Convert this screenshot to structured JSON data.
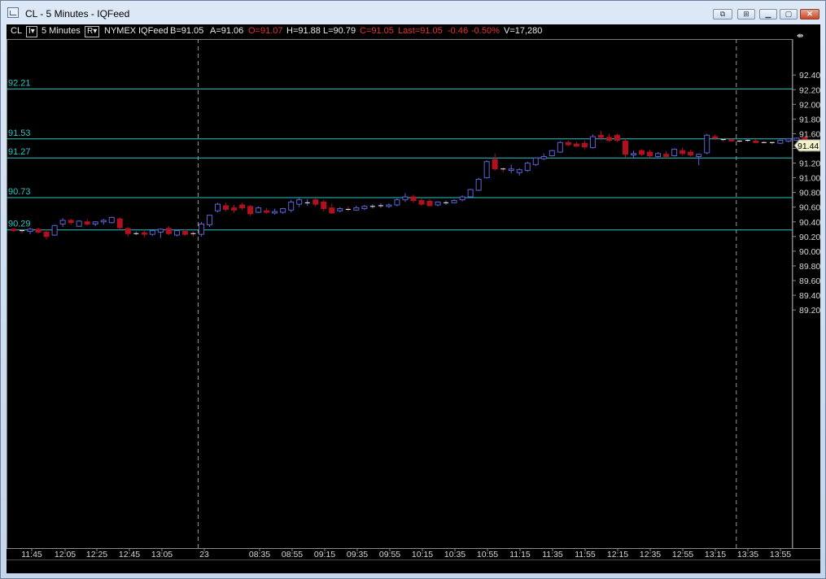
{
  "window": {
    "title": "CL - 5 Minutes - IQFeed",
    "buttons": [
      {
        "name": "restore-pane-button",
        "glyph": "⧉"
      },
      {
        "name": "tile-button",
        "glyph": "⊞"
      },
      {
        "name": "minimize-button",
        "glyph": "▁"
      },
      {
        "name": "maximize-button",
        "glyph": "▢"
      },
      {
        "name": "close-button",
        "glyph": "✕"
      }
    ]
  },
  "header": {
    "symbol": "CL",
    "interval_box": "I▾",
    "interval": "5 Minutes",
    "range_box": "R▾",
    "exchange": "NYMEX",
    "feed": "IQFeed",
    "bid": "B=91.05",
    "ask": "A=91.06",
    "open": "O=91.07",
    "high": "H=91.88",
    "low": "L=90.79",
    "close": "C=91.05",
    "last": "Last=91.05",
    "change": "-0.46",
    "change_pct": "-0.50%",
    "volume": "V=17,280",
    "expand_icon": "⇼"
  },
  "colors": {
    "background": "#000000",
    "up_candle": "#5d63d6",
    "down_candle": "#b01020",
    "level_line": "#2ec6c6",
    "axis_text": "#d6d6d6",
    "header_red": "#e53232",
    "last_price_tag": "#f2f2cc"
  },
  "levels": [
    "92.21",
    "91.53",
    "91.27",
    "90.73",
    "90.29"
  ],
  "last_price_tag": "91.44",
  "chart_data": {
    "type": "candlestick",
    "ylim": [
      89.2,
      92.6
    ],
    "y_ticks": [
      "92.40",
      "92.20",
      "92.00",
      "91.80",
      "91.60",
      "91.40",
      "91.20",
      "91.00",
      "90.80",
      "90.60",
      "90.40",
      "90.20",
      "90.00",
      "89.80",
      "89.60",
      "89.40",
      "89.20"
    ],
    "x_ticks": [
      "11:45",
      "12:05",
      "12:25",
      "12:45",
      "13:05",
      "23",
      "08:35",
      "08:55",
      "09:15",
      "09:35",
      "09:55",
      "10:15",
      "10:35",
      "10:55",
      "11:15",
      "11:35",
      "11:55",
      "12:15",
      "12:35",
      "12:55",
      "13:15",
      "13:35",
      "13:55"
    ],
    "session_breaks_after_bar": [
      22,
      88
    ],
    "candles": [
      [
        90.3,
        90.31,
        90.26,
        90.28
      ],
      [
        90.28,
        90.31,
        90.24,
        90.27
      ],
      [
        90.27,
        90.32,
        90.23,
        90.3
      ],
      [
        90.3,
        90.32,
        90.24,
        90.26
      ],
      [
        90.26,
        90.3,
        90.16,
        90.2
      ],
      [
        90.22,
        90.36,
        90.21,
        90.35
      ],
      [
        90.37,
        90.45,
        90.33,
        90.42
      ],
      [
        90.42,
        90.44,
        90.36,
        90.39
      ],
      [
        90.34,
        90.42,
        90.33,
        90.41
      ],
      [
        90.4,
        90.44,
        90.35,
        90.37
      ],
      [
        90.37,
        90.41,
        90.34,
        90.4
      ],
      [
        90.4,
        90.44,
        90.36,
        90.42
      ],
      [
        90.39,
        90.47,
        90.38,
        90.46
      ],
      [
        90.44,
        90.46,
        90.29,
        90.32
      ],
      [
        90.31,
        90.33,
        90.2,
        90.24
      ],
      [
        90.24,
        90.27,
        90.22,
        90.24
      ],
      [
        90.25,
        90.29,
        90.19,
        90.23
      ],
      [
        90.23,
        90.3,
        90.21,
        90.28
      ],
      [
        90.26,
        90.31,
        90.18,
        90.3
      ],
      [
        90.31,
        90.34,
        90.22,
        90.24
      ],
      [
        90.22,
        90.29,
        90.2,
        90.28
      ],
      [
        90.27,
        90.3,
        90.21,
        90.23
      ],
      [
        90.24,
        90.27,
        90.2,
        90.23
      ],
      [
        90.23,
        90.4,
        90.2,
        90.37
      ],
      [
        90.36,
        90.5,
        90.33,
        90.49
      ],
      [
        90.55,
        90.66,
        90.53,
        90.64
      ],
      [
        90.62,
        90.66,
        90.54,
        90.57
      ],
      [
        90.59,
        90.63,
        90.52,
        90.56
      ],
      [
        90.63,
        90.66,
        90.56,
        90.59
      ],
      [
        90.61,
        90.63,
        90.48,
        90.51
      ],
      [
        90.53,
        90.61,
        90.52,
        90.59
      ],
      [
        90.55,
        90.59,
        90.51,
        90.53
      ],
      [
        90.52,
        90.58,
        90.5,
        90.54
      ],
      [
        90.53,
        90.59,
        90.51,
        90.58
      ],
      [
        90.56,
        90.7,
        90.53,
        90.67
      ],
      [
        90.64,
        90.73,
        90.6,
        90.7
      ],
      [
        90.66,
        90.71,
        90.62,
        90.66
      ],
      [
        90.7,
        90.72,
        90.61,
        90.64
      ],
      [
        90.67,
        90.7,
        90.54,
        90.58
      ],
      [
        90.59,
        90.65,
        90.51,
        90.52
      ],
      [
        90.55,
        90.6,
        90.53,
        90.58
      ],
      [
        90.57,
        90.61,
        90.54,
        90.56
      ],
      [
        90.56,
        90.62,
        90.55,
        90.59
      ],
      [
        90.58,
        90.63,
        90.56,
        90.61
      ],
      [
        90.61,
        90.64,
        90.58,
        90.61
      ],
      [
        90.61,
        90.65,
        90.59,
        90.62
      ],
      [
        90.61,
        90.65,
        90.59,
        90.63
      ],
      [
        90.63,
        90.72,
        90.61,
        90.7
      ],
      [
        90.7,
        90.79,
        90.67,
        90.74
      ],
      [
        90.74,
        90.77,
        90.66,
        90.69
      ],
      [
        90.69,
        90.72,
        90.62,
        90.64
      ],
      [
        90.68,
        90.71,
        90.61,
        90.62
      ],
      [
        90.63,
        90.68,
        90.61,
        90.67
      ],
      [
        90.65,
        90.69,
        90.63,
        90.66
      ],
      [
        90.66,
        90.71,
        90.65,
        90.69
      ],
      [
        90.7,
        90.76,
        90.68,
        90.74
      ],
      [
        90.74,
        90.85,
        90.73,
        90.84
      ],
      [
        90.83,
        91.0,
        90.82,
        90.98
      ],
      [
        91.0,
        91.24,
        90.99,
        91.22
      ],
      [
        91.25,
        91.33,
        91.1,
        91.12
      ],
      [
        91.12,
        91.14,
        91.07,
        91.11
      ],
      [
        91.1,
        91.18,
        91.06,
        91.12
      ],
      [
        91.07,
        91.13,
        91.03,
        91.11
      ],
      [
        91.1,
        91.22,
        91.08,
        91.2
      ],
      [
        91.18,
        91.28,
        91.16,
        91.27
      ],
      [
        91.26,
        91.33,
        91.24,
        91.29
      ],
      [
        91.3,
        91.38,
        91.29,
        91.37
      ],
      [
        91.35,
        91.5,
        91.34,
        91.48
      ],
      [
        91.48,
        91.51,
        91.43,
        91.45
      ],
      [
        91.46,
        91.49,
        91.42,
        91.43
      ],
      [
        91.47,
        91.51,
        91.39,
        91.42
      ],
      [
        91.41,
        91.59,
        91.4,
        91.56
      ],
      [
        91.58,
        91.64,
        91.51,
        91.55
      ],
      [
        91.55,
        91.6,
        91.49,
        91.51
      ],
      [
        91.58,
        91.6,
        91.49,
        91.51
      ],
      [
        91.5,
        91.53,
        91.28,
        91.32
      ],
      [
        91.31,
        91.37,
        91.26,
        91.33
      ],
      [
        91.37,
        91.39,
        91.3,
        91.32
      ],
      [
        91.35,
        91.38,
        91.27,
        91.3
      ],
      [
        91.29,
        91.35,
        91.28,
        91.33
      ],
      [
        91.32,
        91.36,
        91.28,
        91.29
      ],
      [
        91.3,
        91.4,
        91.29,
        91.39
      ],
      [
        91.37,
        91.41,
        91.3,
        91.33
      ],
      [
        91.35,
        91.38,
        91.29,
        91.31
      ],
      [
        91.29,
        91.33,
        91.17,
        91.32
      ],
      [
        91.34,
        91.6,
        91.32,
        91.58
      ],
      [
        91.56,
        91.59,
        91.51,
        91.54
      ],
      [
        91.52,
        91.54,
        91.49,
        91.51
      ],
      [
        91.52,
        91.53,
        91.49,
        91.5
      ],
      [
        91.5,
        91.51,
        91.48,
        91.49
      ],
      [
        91.51,
        91.52,
        91.49,
        91.51
      ],
      [
        91.5,
        91.52,
        91.47,
        91.48
      ],
      [
        91.48,
        91.5,
        91.47,
        91.47
      ],
      [
        91.48,
        91.49,
        91.46,
        91.48
      ],
      [
        91.47,
        91.52,
        91.46,
        91.51
      ],
      [
        91.5,
        91.54,
        91.48,
        91.53
      ],
      [
        91.51,
        91.55,
        91.5,
        91.54
      ],
      [
        91.55,
        91.56,
        91.49,
        91.5
      ],
      [
        91.5,
        91.52,
        91.43,
        91.45
      ],
      [
        91.45,
        91.47,
        91.4,
        91.44
      ]
    ]
  }
}
